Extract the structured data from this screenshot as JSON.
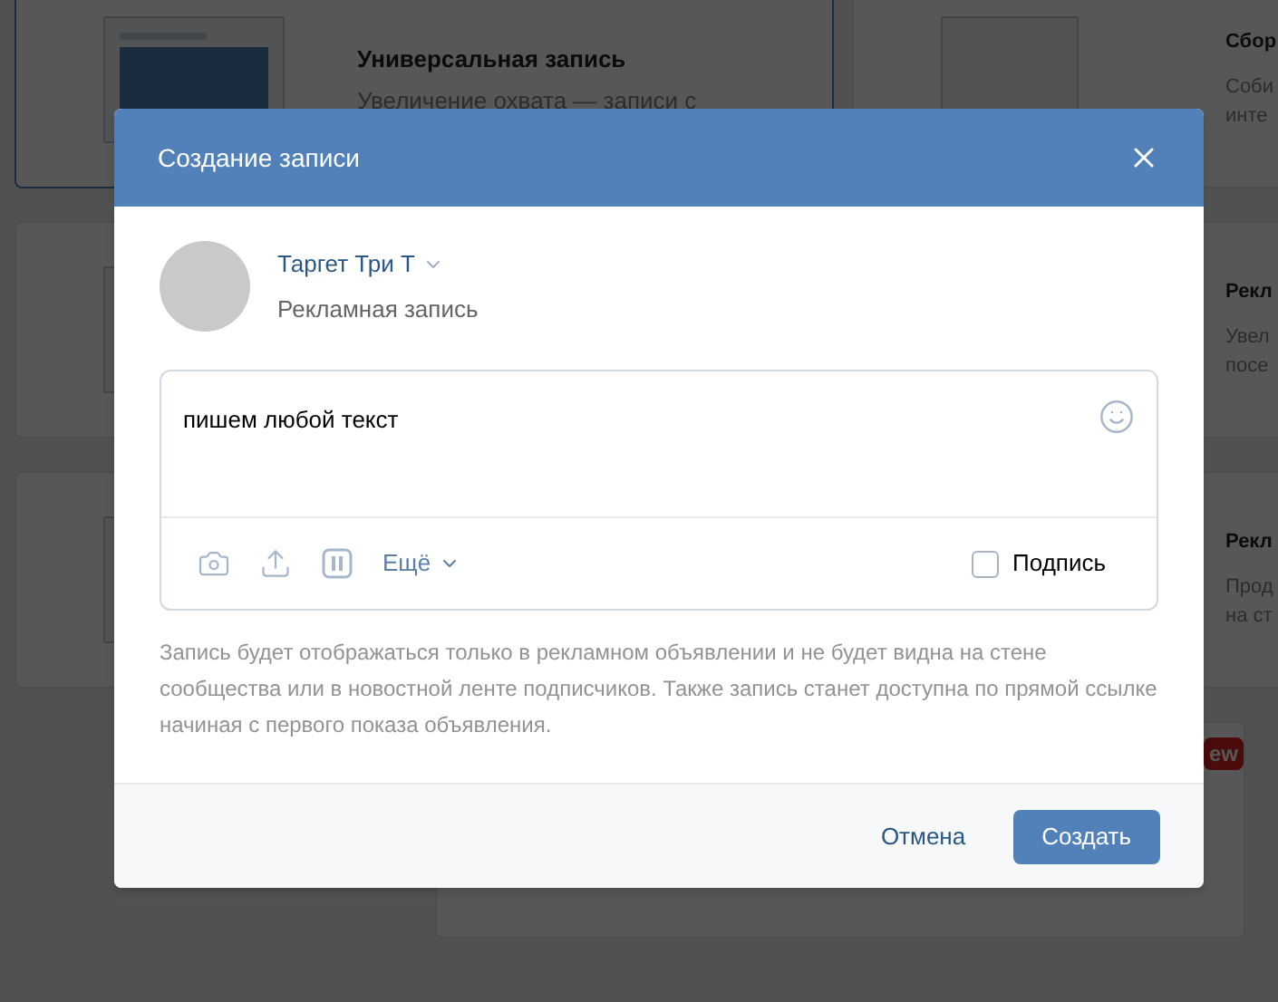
{
  "background": {
    "rows": [
      {
        "left": {
          "title": "Универсальная запись",
          "description": "Увеличение охвата — записи с",
          "selected": true
        },
        "right": {
          "title": "Сбор",
          "lines": [
            "Соби",
            "инте"
          ]
        }
      },
      {
        "left": {
          "selected": false
        },
        "right": {
          "title": "Рекл",
          "lines": [
            "Увел",
            "посе"
          ]
        }
      },
      {
        "left": {
          "selected": false
        },
        "right": {
          "title": "Рекл",
          "lines": [
            "Прод",
            "на ст"
          ]
        }
      }
    ],
    "badge": "ew"
  },
  "dialog": {
    "title": "Создание записи",
    "author": {
      "name": "Таргет Три Т",
      "subtitle": "Рекламная запись"
    },
    "post": {
      "value": "пишем любой текст"
    },
    "toolbar": {
      "more": "Ещё",
      "signature": {
        "label": "Подпись",
        "checked": false
      }
    },
    "note": "Запись будет отображаться только в рекламном объявлении и не будет видна на стене сообщества или в новостной ленте подписчиков. Также запись станет доступна по прямой ссылке начиная с первого показа объявления.",
    "buttons": {
      "cancel": "Отмена",
      "submit": "Создать"
    }
  }
}
